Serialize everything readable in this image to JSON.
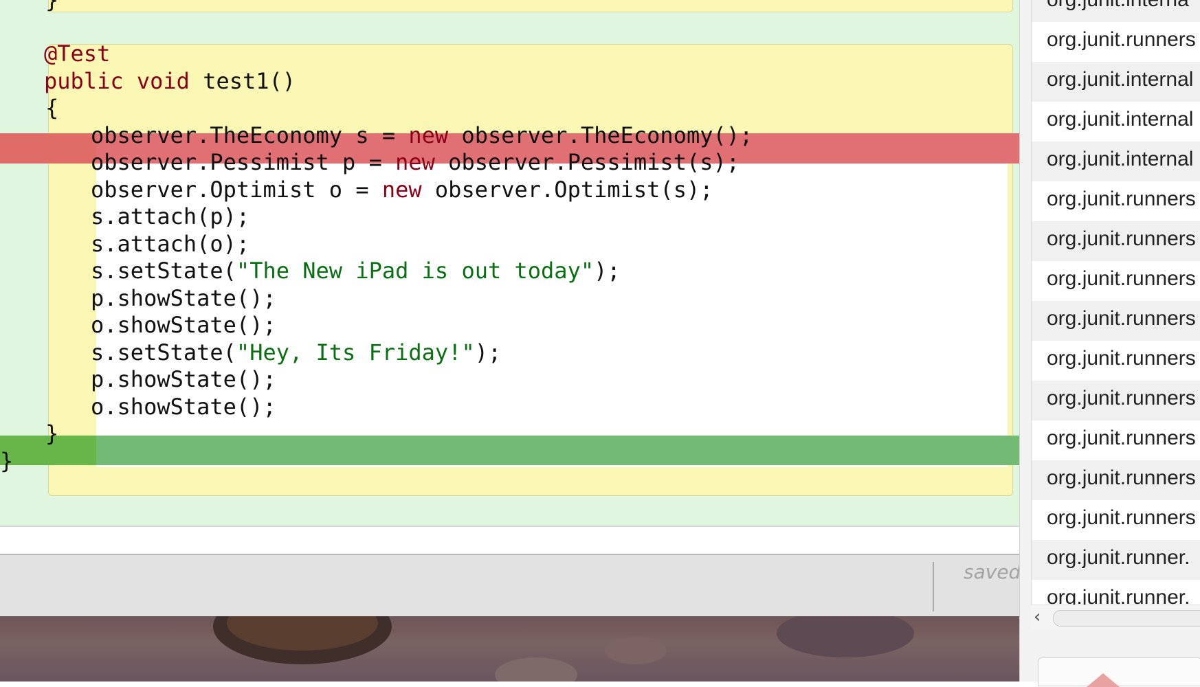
{
  "editor": {
    "prev_method_close": "}",
    "annotation": "@Test",
    "signature": {
      "public": "public",
      "void": "void",
      "name": " test1()"
    },
    "open_brace": "{",
    "lines": [
      {
        "pre": "observer.TheEconomy s = ",
        "kw": "new",
        "post": " observer.TheEconomy();"
      },
      {
        "pre": "observer.Pessimist p = ",
        "kw": "new",
        "post": " observer.Pessimist(s);"
      },
      {
        "pre": "observer.Optimist o = ",
        "kw": "new",
        "post": " observer.Optimist(s);"
      },
      {
        "text": "s.attach(p);"
      },
      {
        "text": "s.attach(o);"
      },
      {
        "pre": "s.setState(",
        "str": "\"The New iPad is out today\"",
        "post": ");"
      },
      {
        "text": "p.showState();"
      },
      {
        "text": "o.showState();"
      },
      {
        "pre": "s.setState(",
        "str": "\"Hey, Its Friday!\"",
        "post": ");"
      },
      {
        "text": "p.showState();"
      },
      {
        "text": "o.showState();"
      }
    ],
    "method_close": "}",
    "class_close": "}",
    "highlight_colors": {
      "error_line": "#e07074",
      "current_line": "#73bb74",
      "method_bg": "#f9f7b3",
      "class_bg": "#e0f6df"
    }
  },
  "statusbar": {
    "saved": "saved"
  },
  "sidepanel": {
    "rows": [
      "org.junit.interna",
      "org.junit.runners",
      "org.junit.internal",
      "org.junit.internal",
      "org.junit.internal",
      "org.junit.runners",
      "org.junit.runners",
      "org.junit.runners",
      "org.junit.runners",
      "org.junit.runners",
      "org.junit.runners",
      "org.junit.runners",
      "org.junit.runners",
      "org.junit.runners",
      "org.junit.runner.",
      "org.junit.runner."
    ],
    "scroll_left_icon": "‹"
  }
}
